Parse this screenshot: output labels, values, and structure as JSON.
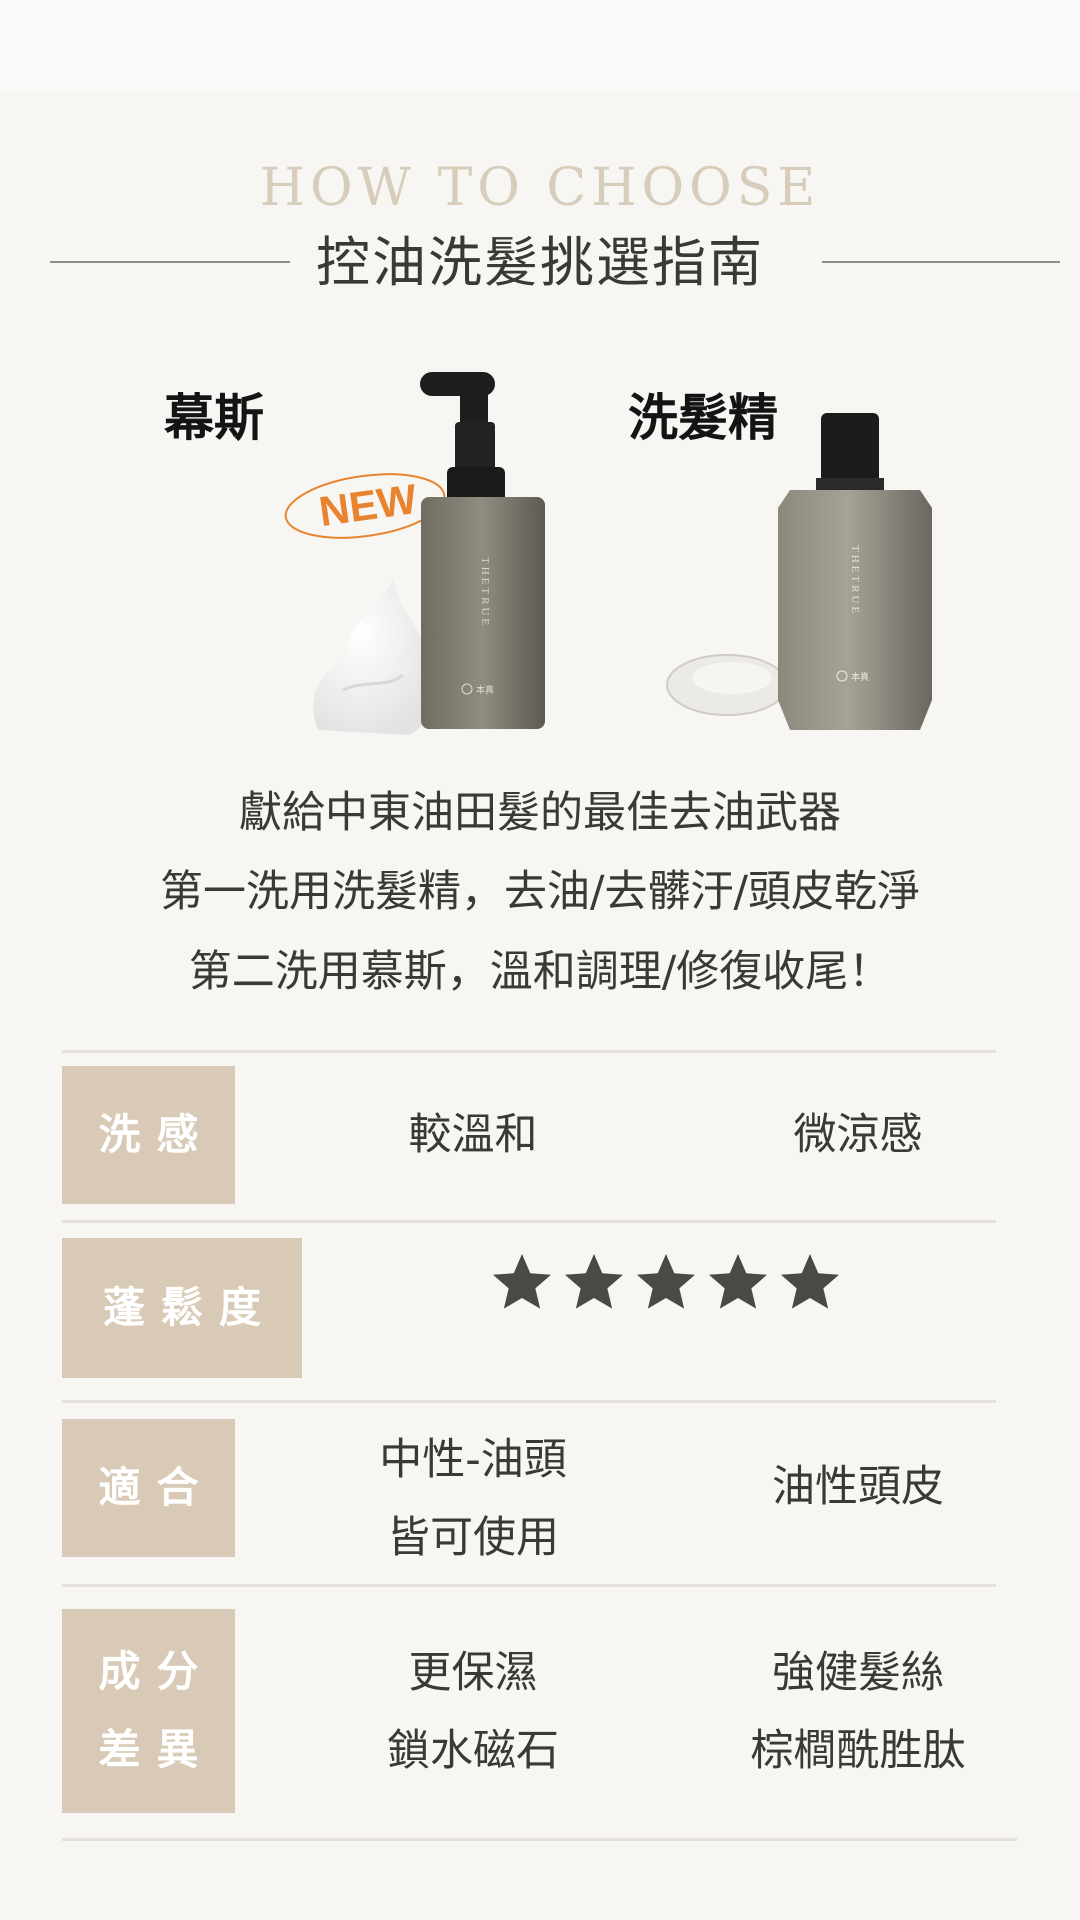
{
  "header": {
    "eyebrow": "HOW TO CHOOSE",
    "title": "控油洗髮挑選指南"
  },
  "products": {
    "mousse": {
      "label": "幕斯",
      "badge": "NEW",
      "bottle_text": "THETRUE",
      "logo_text": "本真"
    },
    "shampoo": {
      "label": "洗髮精",
      "bottle_text": "THETRUE",
      "logo_text": "本真"
    }
  },
  "tagline": [
    "獻給中東油田髮的最佳去油武器",
    "第一洗用洗髮精，去油/去髒汙/頭皮乾淨",
    "第二洗用慕斯，溫和調理/修復收尾！"
  ],
  "comparison": {
    "rows": [
      {
        "label": "洗感",
        "mousse": "較溫和",
        "shampoo": "微涼感"
      },
      {
        "label": "蓬鬆度",
        "rating": 5,
        "rating_max": 5
      },
      {
        "label": "適合",
        "mousse": [
          "中性-油頭",
          "皆可使用"
        ],
        "shampoo": "油性頭皮"
      },
      {
        "label": [
          "成分",
          "差異"
        ],
        "mousse": [
          "更保濕",
          "鎖水磁石"
        ],
        "shampoo": [
          "強健髮絲",
          "棕櫚酰胜肽"
        ]
      }
    ]
  },
  "colors": {
    "background": "#f7f6f3",
    "tag": "#d8cab6",
    "eyebrow": "#d8ccbb",
    "star": "#4a4943",
    "badge": "#e8842f"
  }
}
